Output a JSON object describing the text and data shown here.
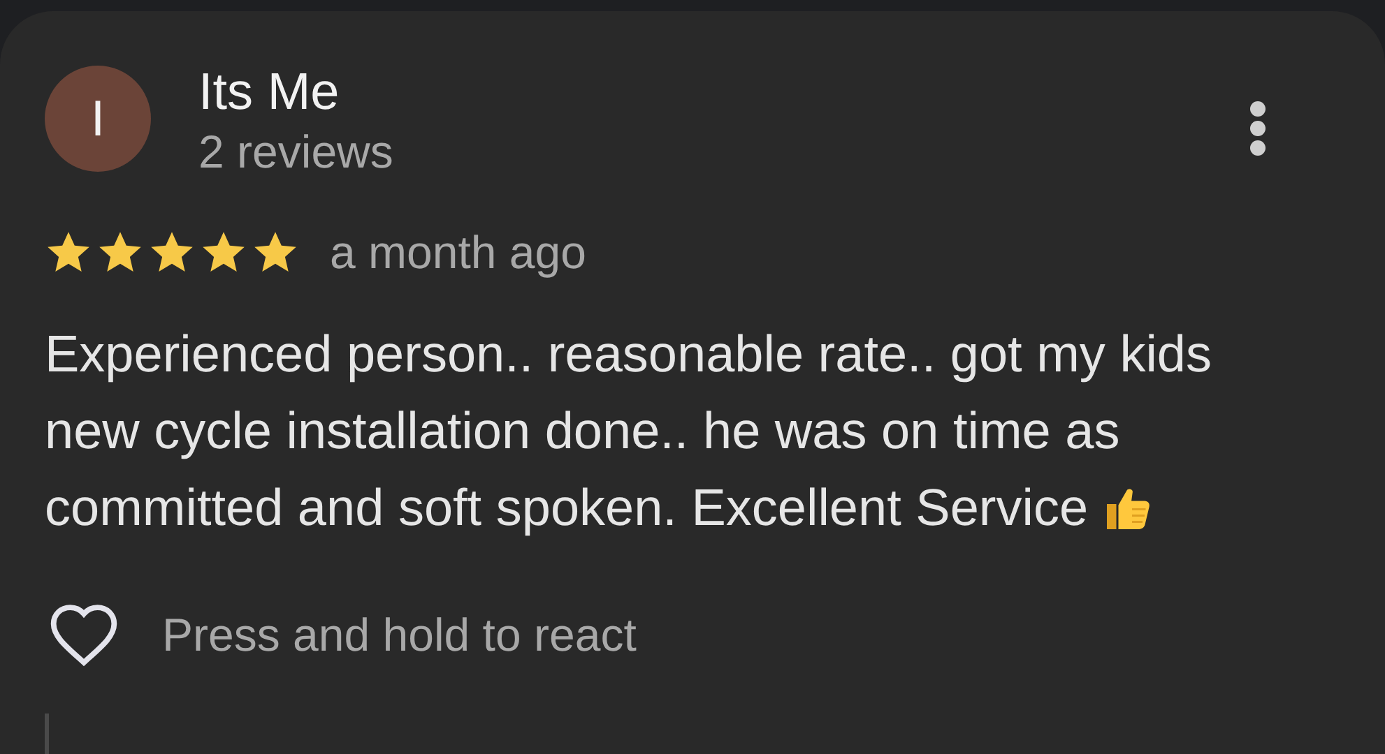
{
  "review": {
    "avatar_initial": "I",
    "author": "Its Me",
    "review_count": "2 reviews",
    "stars": 5,
    "time": "a month ago",
    "text": "Experienced person.. reasonable rate.. got my kids new cycle installation done.. he was on time as committed and soft spoken. Excellent Service",
    "reaction_hint": "Press and hold to react"
  }
}
